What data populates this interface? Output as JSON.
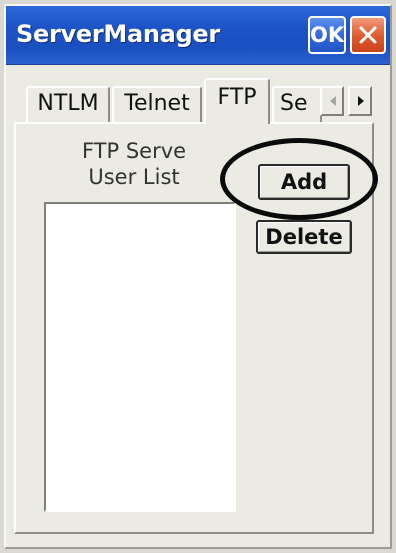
{
  "window": {
    "title": "ServerManager",
    "ok_label": "OK",
    "close_icon": "close-icon"
  },
  "tabs": [
    {
      "label": "NTLM",
      "active": false
    },
    {
      "label": "Telnet",
      "active": false
    },
    {
      "label": "FTP",
      "active": true
    },
    {
      "label": "Se",
      "active": false
    }
  ],
  "tab_scroll": {
    "left_icon": "chevron-left-icon",
    "right_icon": "chevron-right-icon"
  },
  "ftp_panel": {
    "list_label_line1": "FTP Serve",
    "list_label_line2": "User List",
    "add_label": "Add",
    "delete_label": "Delete"
  },
  "colors": {
    "titlebar": "#1d55c8",
    "close_button": "#e0582e",
    "window_background": "#ecebe3"
  }
}
